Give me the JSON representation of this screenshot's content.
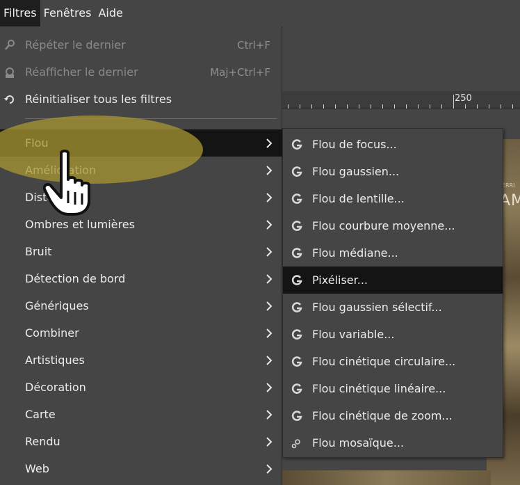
{
  "menubar": {
    "items": [
      {
        "label": "Filtres",
        "active": true
      },
      {
        "label": "Fenêtres",
        "active": false
      },
      {
        "label": "Aide",
        "active": false
      }
    ]
  },
  "ruler": {
    "label": "250"
  },
  "photo": {
    "text": "AM",
    "small_text": "ERRI"
  },
  "filters_menu": {
    "top_items": [
      {
        "label": "Répéter le dernier",
        "shortcut": "Ctrl+F",
        "icon": "repeat-gear-icon",
        "disabled": true
      },
      {
        "label": "Réafficher le dernier",
        "shortcut": "Maj+Ctrl+F",
        "icon": "reshow-gear-icon",
        "disabled": true
      },
      {
        "label": "Réinitialiser tous les filtres",
        "shortcut": "",
        "icon": "reset-icon",
        "disabled": false
      }
    ],
    "categories": [
      {
        "label": "Flou",
        "highlighted": true
      },
      {
        "label": "Amélioration",
        "highlighted": false
      },
      {
        "label": "Distorsions",
        "highlighted": false
      },
      {
        "label": "Ombres et lumières",
        "highlighted": false
      },
      {
        "label": "Bruit",
        "highlighted": false
      },
      {
        "label": "Détection de bord",
        "highlighted": false
      },
      {
        "label": "Génériques",
        "highlighted": false
      },
      {
        "label": "Combiner",
        "highlighted": false
      },
      {
        "label": "Artistiques",
        "highlighted": false
      },
      {
        "label": "Décoration",
        "highlighted": false
      },
      {
        "label": "Carte",
        "highlighted": false
      },
      {
        "label": "Rendu",
        "highlighted": false
      },
      {
        "label": "Web",
        "highlighted": false
      }
    ]
  },
  "blur_submenu": {
    "items": [
      {
        "label": "Flou de focus...",
        "icon": "gegl-icon",
        "highlighted": false
      },
      {
        "label": "Flou gaussien...",
        "icon": "gegl-icon",
        "highlighted": false
      },
      {
        "label": "Flou de lentille...",
        "icon": "gegl-icon",
        "highlighted": false
      },
      {
        "label": "Flou courbure moyenne...",
        "icon": "gegl-icon",
        "highlighted": false
      },
      {
        "label": "Flou médiane...",
        "icon": "gegl-icon",
        "highlighted": false
      },
      {
        "label": "Pixéliser...",
        "icon": "gegl-icon",
        "highlighted": true
      },
      {
        "label": "Flou gaussien sélectif...",
        "icon": "gegl-icon",
        "highlighted": false
      },
      {
        "label": "Flou variable...",
        "icon": "gegl-icon",
        "highlighted": false
      },
      {
        "label": "Flou cinétique circulaire...",
        "icon": "gegl-icon",
        "highlighted": false
      },
      {
        "label": "Flou cinétique linéaire...",
        "icon": "gegl-icon",
        "highlighted": false
      },
      {
        "label": "Flou cinétique de zoom...",
        "icon": "gegl-icon",
        "highlighted": false
      },
      {
        "label": "Flou mosaïque...",
        "icon": "gear-icon",
        "highlighted": false
      }
    ]
  },
  "colors": {
    "menu_bg": "#454545",
    "highlight_bg": "#141414",
    "halo": "#a89630",
    "text": "#ececec",
    "disabled_text": "#8a8a8a"
  }
}
